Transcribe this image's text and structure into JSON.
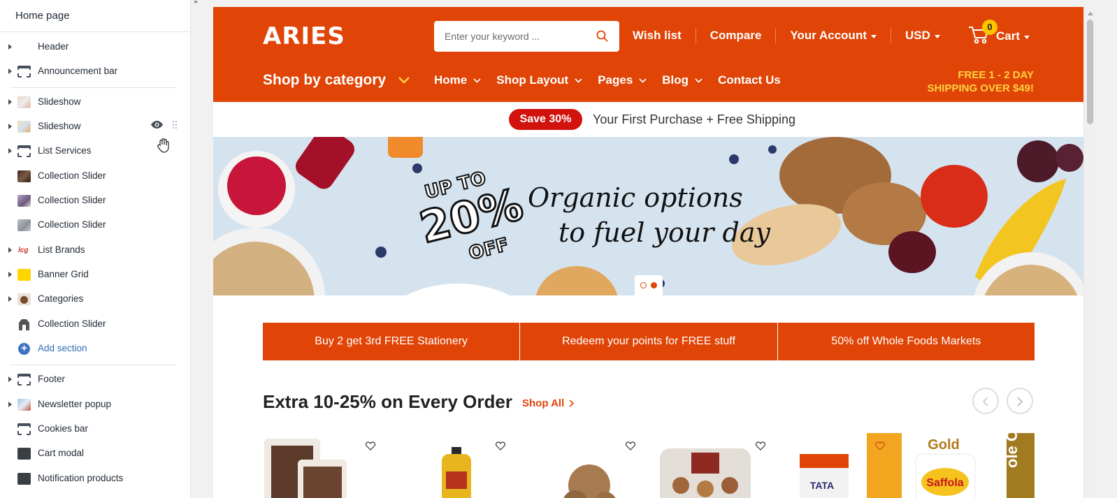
{
  "sidebar": {
    "title": "Home page",
    "items": [
      {
        "label": "Header"
      },
      {
        "label": "Announcement bar"
      },
      {
        "label": "Slideshow"
      },
      {
        "label": "Slideshow"
      },
      {
        "label": "List Services"
      },
      {
        "label": "Collection Slider"
      },
      {
        "label": "Collection Slider"
      },
      {
        "label": "Collection Slider"
      },
      {
        "label": "List Brands"
      },
      {
        "label": "Banner Grid"
      },
      {
        "label": "Categories"
      },
      {
        "label": "Collection Slider"
      }
    ],
    "add_section_label": "Add section",
    "footer_items": [
      {
        "label": "Footer"
      },
      {
        "label": "Newsletter popup"
      },
      {
        "label": "Cookies bar"
      },
      {
        "label": "Cart modal"
      },
      {
        "label": "Notification products"
      }
    ]
  },
  "site": {
    "logo": "ARIES",
    "search_placeholder": "Enter your keyword ...",
    "wish_list": "Wish list",
    "compare": "Compare",
    "account": "Your Account",
    "currency": "USD",
    "cart_count": "0",
    "cart_label": "Cart",
    "shop_by_category": "Shop by category",
    "nav": [
      "Home",
      "Shop Layout",
      "Pages",
      "Blog",
      "Contact Us"
    ],
    "shipping_line1": "FREE 1 - 2 DAY",
    "shipping_line2": "SHIPPING OVER $49!",
    "accent": "#e04406",
    "highlight": "#ffd23f"
  },
  "announcement": {
    "pill": "Save 30%",
    "text": "Your First Purchase + Free Shipping"
  },
  "hero": {
    "up_to": "UP TO",
    "percent": "20%",
    "off": "OFF",
    "line1": "Organic options",
    "line2": "to fuel your day"
  },
  "services": [
    "Buy 2 get 3rd FREE Stationery",
    "Redeem your points for FREE stuff",
    "50% off Whole Foods Markets"
  ],
  "collection": {
    "title": "Extra 10-25% on Every Order",
    "shop_all": "Shop All",
    "products": [
      {
        "name": "Nuts pack"
      },
      {
        "name": "Oil bottle"
      },
      {
        "name": "Whole nuts"
      },
      {
        "name": "Mixed nuts tray"
      },
      {
        "name": "Salt box",
        "brand_text": "TATA"
      },
      {
        "name": "Oil pouch",
        "brand_text": "Saffola",
        "badge_text": "Gold",
        "side_text": "ole Oil"
      }
    ]
  }
}
